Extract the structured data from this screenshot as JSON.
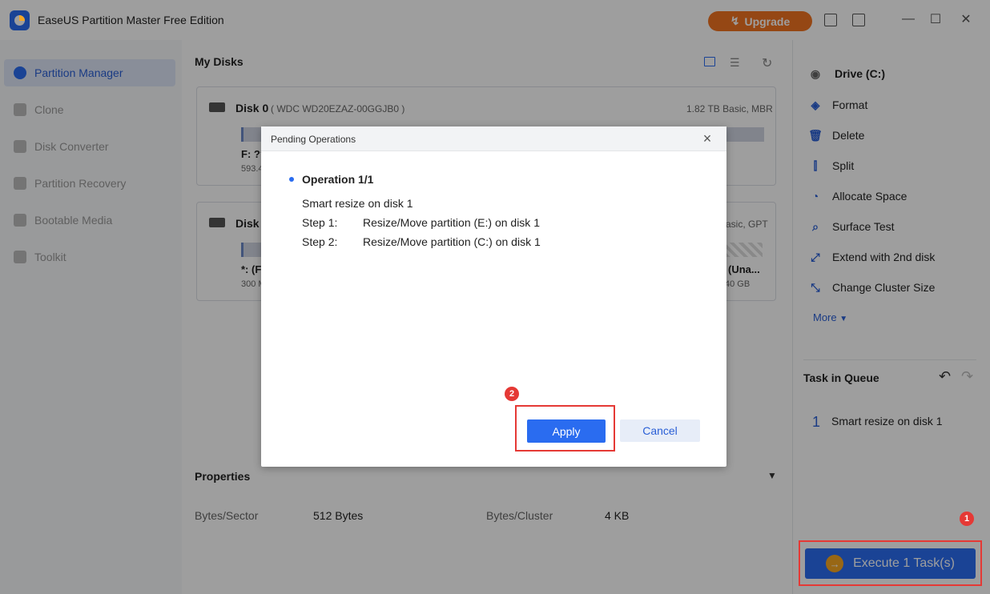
{
  "app": {
    "title": "EaseUS Partition Master Free Edition",
    "upgrade_label": "Upgrade"
  },
  "sidebar": {
    "items": [
      {
        "label": "Partition Manager",
        "active": true
      },
      {
        "label": "Clone"
      },
      {
        "label": "Disk Converter"
      },
      {
        "label": "Partition Recovery"
      },
      {
        "label": "Bootable Media"
      },
      {
        "label": "Toolkit"
      }
    ]
  },
  "main": {
    "title": "My Disks",
    "disk0": {
      "name": "Disk 0",
      "model": "( WDC WD20EZAZ-00GGJB0 )",
      "info": "1.82 TB Basic, MBR",
      "partition_label": "F: ??",
      "partition_size": "593.4"
    },
    "disk1": {
      "name": "Disk",
      "info": "asic, GPT",
      "partition_label": "*: (F",
      "partition_size": "300 M",
      "right_label": "(Una...",
      "right_size": "40 GB"
    },
    "properties": {
      "title": "Properties",
      "bytes_sector_label": "Bytes/Sector",
      "bytes_sector_value": "512 Bytes",
      "bytes_cluster_label": "Bytes/Cluster",
      "bytes_cluster_value": "4 KB"
    }
  },
  "right": {
    "drive": "Drive (C:)",
    "operations": [
      {
        "label": "Format"
      },
      {
        "label": "Delete"
      },
      {
        "label": "Split"
      },
      {
        "label": "Allocate Space"
      },
      {
        "label": "Surface Test"
      },
      {
        "label": "Extend with 2nd disk"
      },
      {
        "label": "Change Cluster Size"
      }
    ],
    "more_label": "More",
    "queue_title": "Task in Queue",
    "queue_items": [
      {
        "num": "1",
        "text": "Smart resize on disk 1"
      }
    ],
    "execute_label": "Execute 1 Task(s)"
  },
  "dialog": {
    "title": "Pending Operations",
    "operation_title": "Operation 1/1",
    "summary": "Smart resize on disk 1",
    "steps": [
      {
        "label": "Step 1:",
        "text": "Resize/Move partition (E:) on disk 1"
      },
      {
        "label": "Step 2:",
        "text": "Resize/Move partition (C:) on disk 1"
      }
    ],
    "apply_label": "Apply",
    "cancel_label": "Cancel"
  },
  "annotations": {
    "badge1": "1",
    "badge2": "2"
  },
  "colors": {
    "accent": "#2a6cf0",
    "upgrade": "#f07321",
    "highlight": "#e53935"
  }
}
